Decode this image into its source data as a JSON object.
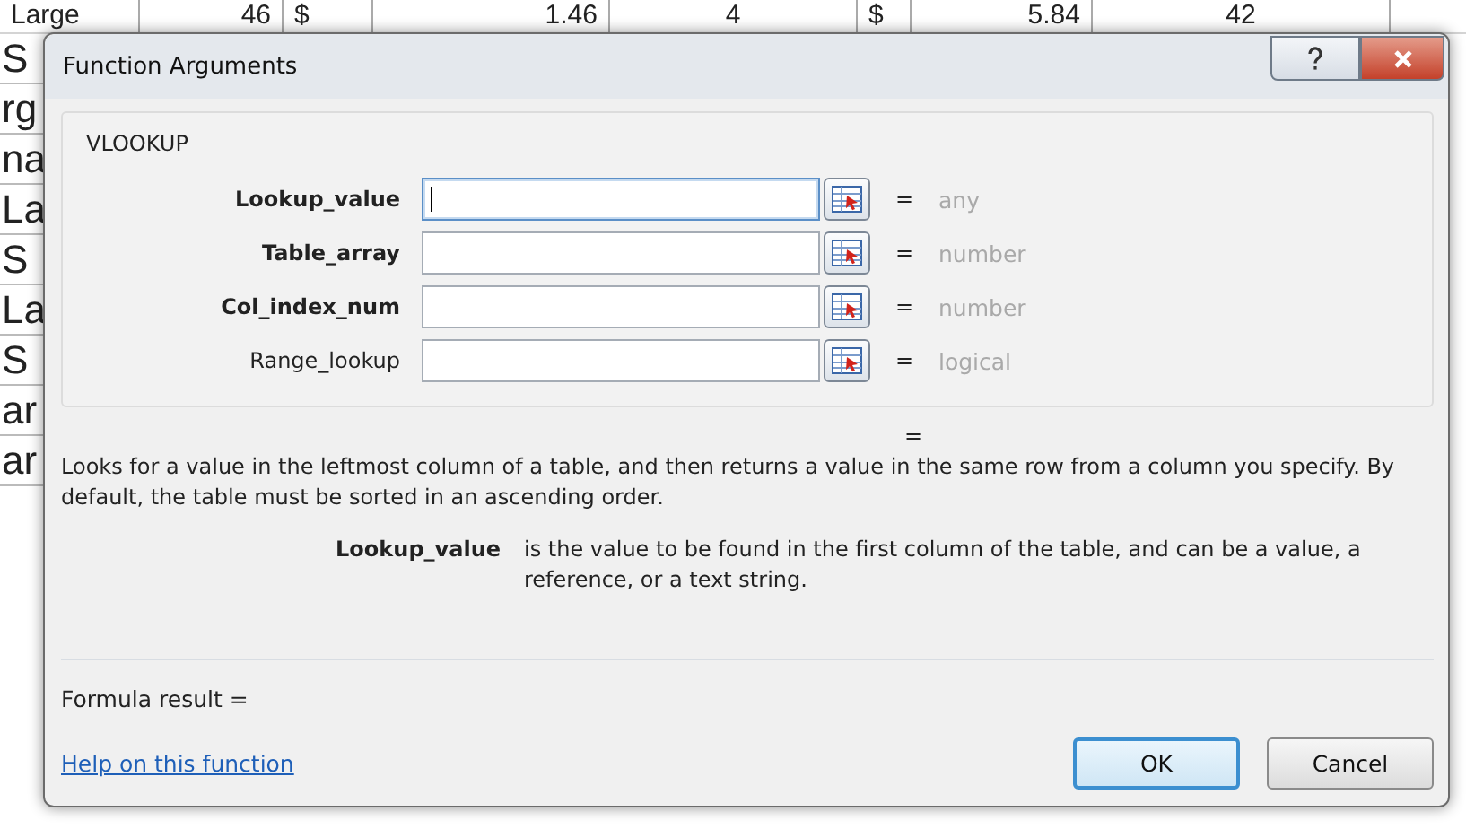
{
  "sheet": {
    "top_row": [
      "Large",
      "46",
      "$",
      "1.46",
      "4",
      "$",
      "5.84",
      "42"
    ],
    "first_column": [
      "S",
      "rg",
      "na",
      "La",
      "S",
      "La",
      "S",
      "ar",
      "ar"
    ]
  },
  "window": {
    "title": "Function Arguments"
  },
  "function": {
    "name": "VLOOKUP",
    "arguments": [
      {
        "label": "Lookup_value",
        "required": true,
        "focused": true,
        "equals": "=",
        "result": "any"
      },
      {
        "label": "Table_array",
        "required": true,
        "focused": false,
        "equals": "=",
        "result": "number"
      },
      {
        "label": "Col_index_num",
        "required": true,
        "focused": false,
        "equals": "=",
        "result": "number"
      },
      {
        "label": "Range_lookup",
        "required": false,
        "focused": false,
        "equals": "=",
        "result": "logical"
      }
    ],
    "result_equals": "=",
    "description": "Looks for a value in the leftmost column of a table, and then returns a value in the same row from a column you specify. By default, the table must be sorted in an ascending order.",
    "argument_help": {
      "label": "Lookup_value",
      "text": "is the value to be found in the first column of the table, and can be a value, a reference, or a text string."
    }
  },
  "formula_result": "Formula result =",
  "help_link": "Help on this function",
  "buttons": [
    {
      "label": "OK",
      "default": true
    },
    {
      "label": "Cancel",
      "default": false
    }
  ]
}
